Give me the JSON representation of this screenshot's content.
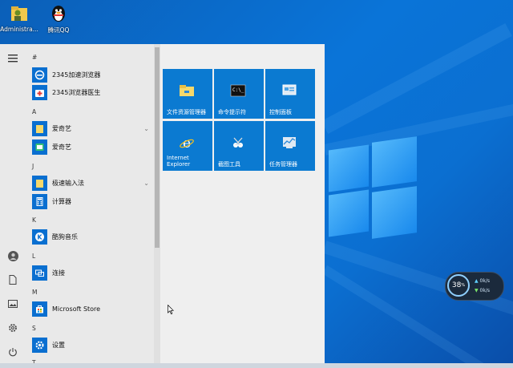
{
  "desktop": {
    "icons": [
      {
        "label": "Administra..."
      },
      {
        "label": "腾讯QQ"
      }
    ]
  },
  "start_menu": {
    "sections": [
      {
        "letter": "#",
        "apps": [
          {
            "name": "2345加速浏览器",
            "icon": "browser-icon",
            "has_chevron": false
          },
          {
            "name": "2345浏览器医生",
            "icon": "medkit-icon",
            "has_chevron": false
          }
        ]
      },
      {
        "letter": "A",
        "apps": [
          {
            "name": "爱奇艺",
            "icon": "folder-icon",
            "has_chevron": true
          },
          {
            "name": "爱奇艺",
            "icon": "iqiyi-icon",
            "has_chevron": false
          }
        ]
      },
      {
        "letter": "J",
        "apps": [
          {
            "name": "极速输入法",
            "icon": "folder-icon",
            "has_chevron": true
          },
          {
            "name": "计算器",
            "icon": "calculator-icon",
            "has_chevron": false
          }
        ]
      },
      {
        "letter": "K",
        "apps": [
          {
            "name": "酷狗音乐",
            "icon": "kugou-icon",
            "has_chevron": false
          }
        ]
      },
      {
        "letter": "L",
        "apps": [
          {
            "name": "连接",
            "icon": "connect-icon",
            "has_chevron": false
          }
        ]
      },
      {
        "letter": "M",
        "apps": [
          {
            "name": "Microsoft Store",
            "icon": "store-icon",
            "has_chevron": false
          }
        ]
      },
      {
        "letter": "S",
        "apps": [
          {
            "name": "设置",
            "icon": "settings-icon",
            "has_chevron": false
          }
        ]
      },
      {
        "letter": "T",
        "apps": []
      }
    ],
    "tiles": [
      {
        "label": "文件资源管理器",
        "icon": "folder-icon"
      },
      {
        "label": "命令提示符",
        "icon": "cmd-icon"
      },
      {
        "label": "控制面板",
        "icon": "control-panel-icon"
      },
      {
        "label": "Internet Explorer",
        "icon": "ie-icon"
      },
      {
        "label": "截图工具",
        "icon": "snipping-icon"
      },
      {
        "label": "任务管理器",
        "icon": "task-manager-icon"
      }
    ]
  },
  "widget": {
    "percent": "38",
    "percent_sign": "%",
    "up_rate": "0k/s",
    "down_rate": "0k/s"
  },
  "colors": {
    "tile_blue": "#0b7ad1",
    "app_icon_blue": "#0a6fd0"
  }
}
